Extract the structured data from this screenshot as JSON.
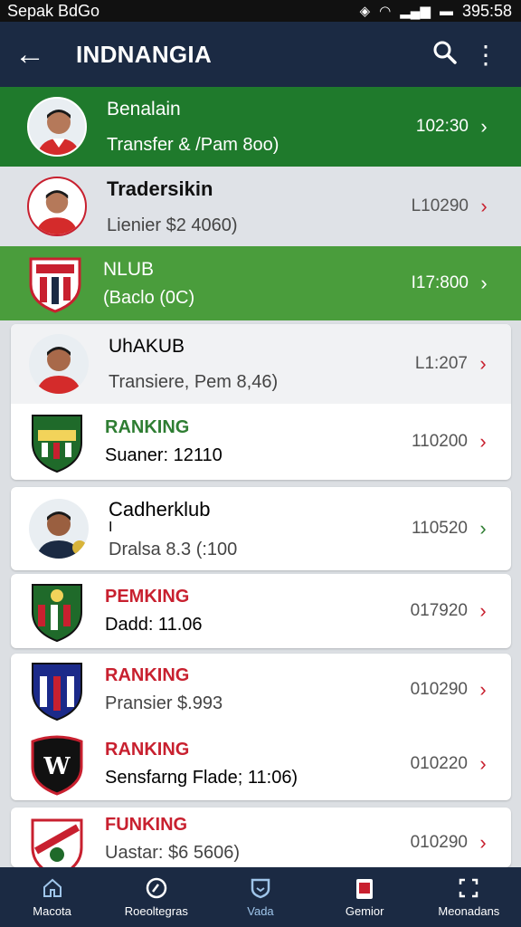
{
  "status": {
    "carrier": "Sepak BdGo",
    "time": "395:58"
  },
  "appbar": {
    "title": "INDNANGIA"
  },
  "rows": [
    {
      "title": "Benalain",
      "subtitle": "Transfer & /Pam 8oo)",
      "value": "102:30"
    },
    {
      "title": "Tradersikin",
      "subtitle": "Lienier $2 4060)",
      "value": "L10290"
    },
    {
      "title": "NLUB",
      "subtitle": "(Baclo (0C)",
      "value": "I17:800"
    }
  ],
  "cards": [
    {
      "title": "UhAKUB",
      "subtitle": "Transiere, Pem 8,46)",
      "value": "L1:207"
    },
    {
      "title": "RANKING",
      "subtitle": "Suaner: 12110",
      "value": "110200"
    },
    {
      "title": "Cadherklub",
      "extra": "I",
      "subtitle": "Dralsa 8.3 (:100",
      "value": "110520"
    },
    {
      "title": "PEMKING",
      "subtitle": "Dadd: 11.06",
      "value": "017920"
    },
    {
      "title": "RANKING",
      "subtitle": "Pransier $.993",
      "value": "010290"
    },
    {
      "title": "RANKING",
      "subtitle": "Sensfarng Flade; 11:06)",
      "value": "010220"
    },
    {
      "title": "FUNKING",
      "subtitle": "Uastar: $6 5606)",
      "value": "010290"
    }
  ],
  "nav": [
    {
      "label": "Macota",
      "icon": "home-icon"
    },
    {
      "label": "Roeoltegras",
      "icon": "chart-icon"
    },
    {
      "label": "Vada",
      "icon": "shield-icon"
    },
    {
      "label": "Gemior",
      "icon": "card-icon"
    },
    {
      "label": "Meonadans",
      "icon": "expand-icon"
    }
  ],
  "colors": {
    "appbar": "#1b2a43",
    "green_dark": "#1f7a2c",
    "green": "#4a9d3c",
    "grey_band": "#dfe2e7",
    "red": "#c8202f",
    "accent_green": "#2e7d32"
  }
}
